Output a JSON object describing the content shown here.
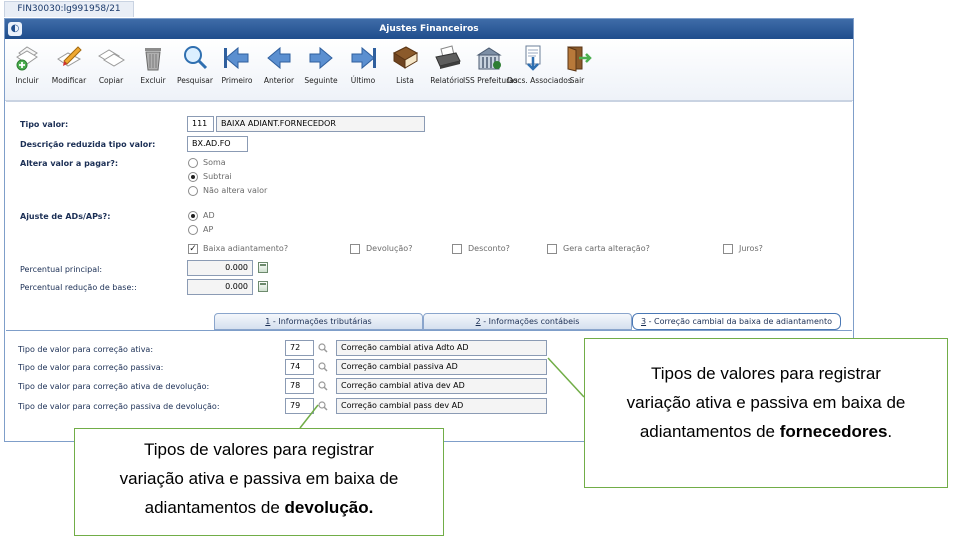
{
  "window": {
    "tab_label": "FIN30030:lg991958/21",
    "title": "Ajustes Financeiros"
  },
  "toolbar": {
    "buttons": [
      {
        "label": "Incluir",
        "icon": "add-doc-icon"
      },
      {
        "label": "Modificar",
        "icon": "edit-pencil-icon"
      },
      {
        "label": "Copiar",
        "icon": "copy-icon"
      },
      {
        "label": "Excluir",
        "icon": "trash-icon"
      },
      {
        "label": "Pesquisar",
        "icon": "search-icon"
      },
      {
        "label": "Primeiro",
        "icon": "first-arrow-icon"
      },
      {
        "label": "Anterior",
        "icon": "previous-arrow-icon"
      },
      {
        "label": "Seguinte",
        "icon": "next-arrow-icon"
      },
      {
        "label": "Último",
        "icon": "last-arrow-icon"
      },
      {
        "label": "Lista",
        "icon": "list-book-icon"
      },
      {
        "label": "Relatório",
        "icon": "printer-icon"
      },
      {
        "label": "ISS Prefeituras",
        "icon": "building-icon"
      },
      {
        "label": "Docs. Associados",
        "icon": "docs-associated-icon"
      },
      {
        "label": "Sair",
        "icon": "exit-door-icon"
      }
    ]
  },
  "form": {
    "tipo_valor_label": "Tipo valor:",
    "tipo_valor_code": "111",
    "tipo_valor_desc": "BAIXA ADIANT.FORNECEDOR",
    "desc_reduzida_label": "Descrição reduzida tipo valor:",
    "desc_reduzida_value": "BX.AD.FO",
    "altera_valor_label": "Altera valor a pagar?:",
    "altera_options": [
      "Soma",
      "Subtrai",
      "Não altera valor"
    ],
    "altera_selected": "Subtrai",
    "ajuste_label": "Ajuste de ADs/APs?:",
    "ajuste_options": [
      "AD",
      "AP"
    ],
    "ajuste_selected": "AD",
    "checkboxes": [
      {
        "label": "Baixa adiantamento?",
        "checked": true
      },
      {
        "label": "Devolução?",
        "checked": false
      },
      {
        "label": "Desconto?",
        "checked": false
      },
      {
        "label": "Gera carta alteração?",
        "checked": false
      },
      {
        "label": "Juros?",
        "checked": false
      }
    ],
    "percentual_principal_label": "Percentual principal:",
    "percentual_principal_value": "0.000",
    "percentual_reducao_label": "Percentual redução de base::",
    "percentual_reducao_value": "0.000"
  },
  "tabs": [
    {
      "key": "1",
      "label": " - Informações tributárias"
    },
    {
      "key": "2",
      "label": " - Informações contábeis"
    },
    {
      "key": "3",
      "label": " - Correção cambial da baixa de adiantamento"
    }
  ],
  "active_tab": "3",
  "correction": {
    "rows": [
      {
        "label": "Tipo de valor para correção ativa:",
        "code": "72",
        "desc": "Correção cambial ativa Adto AD"
      },
      {
        "label": "Tipo de valor para correção passiva:",
        "code": "74",
        "desc": "Correção cambial passiva AD"
      },
      {
        "label": "Tipo de valor para correção ativa de devolução:",
        "code": "78",
        "desc": "Correção cambial ativa dev AD"
      },
      {
        "label": "Tipo de valor para correção passiva de devolução:",
        "code": "79",
        "desc": "Correção cambial pass dev AD"
      }
    ]
  },
  "callouts": {
    "fornecedores": {
      "line1": "Tipos de valores para registrar",
      "line2": "variação ativa e passiva em baixa de",
      "line3_pre": "adiantamentos de ",
      "line3_bold": "fornecedores",
      "line3_post": "."
    },
    "devolucao": {
      "line1": "Tipos de valores para registrar",
      "line2": "variação ativa e passiva em baixa de",
      "line3_pre": "adiantamentos de ",
      "line3_bold": "devolução.",
      "line3_post": ""
    }
  },
  "colors": {
    "title_bar": "#1f4d8c",
    "callout_border": "#71ad47",
    "label_text": "#1b2f55"
  }
}
